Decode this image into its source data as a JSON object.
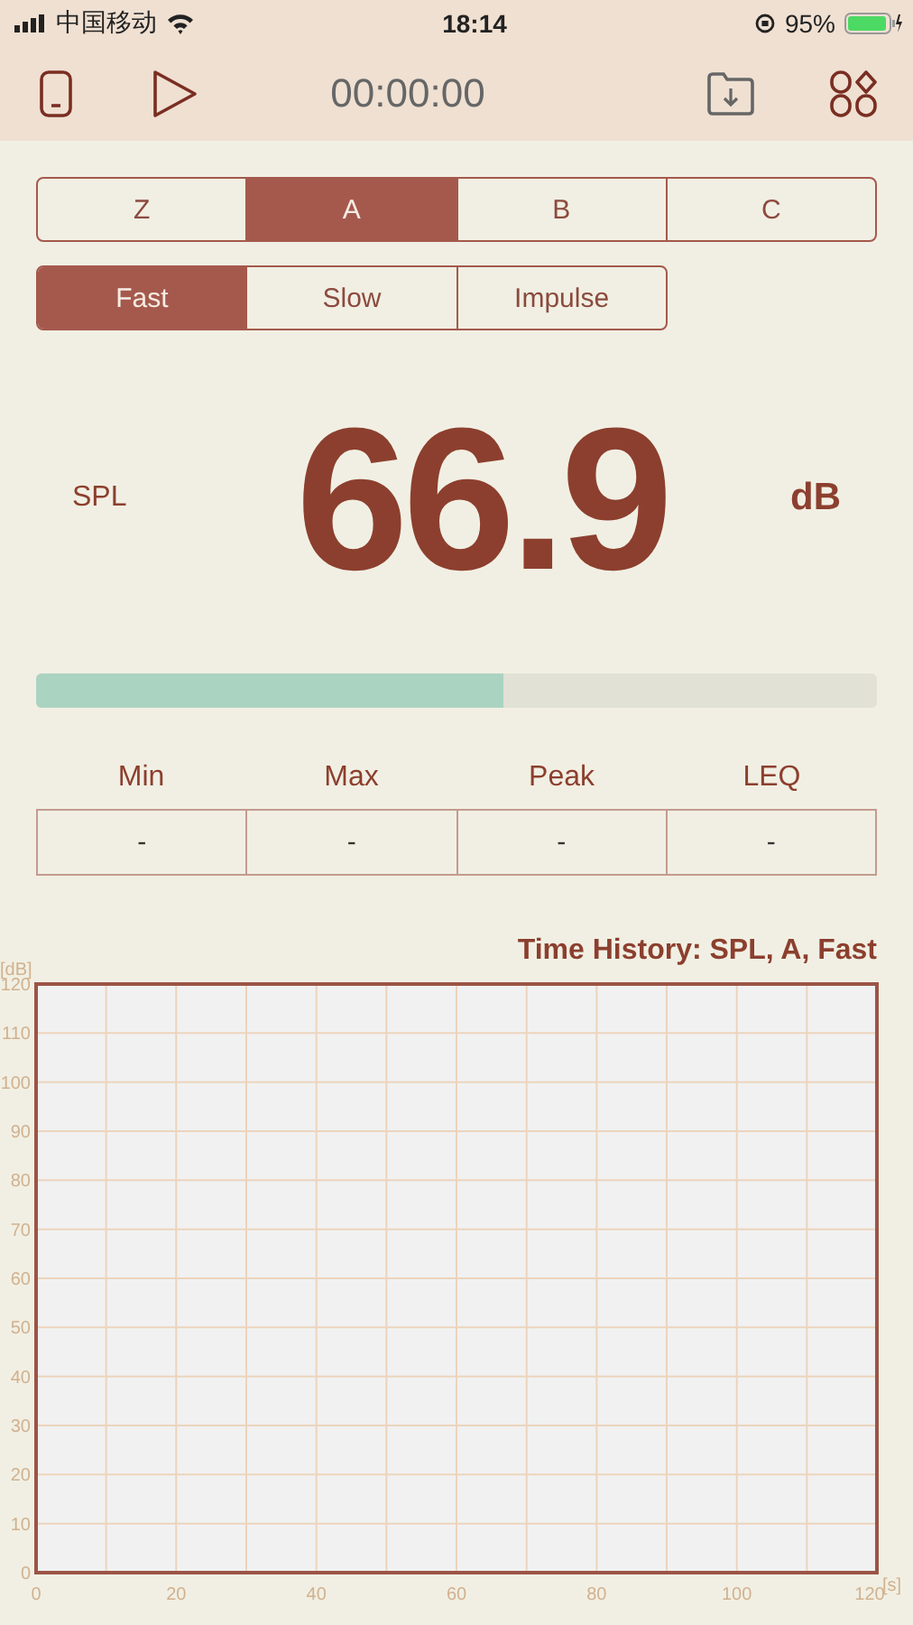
{
  "status_bar": {
    "carrier": "中国移动",
    "time": "18:14",
    "battery": "95%"
  },
  "toolbar": {
    "timer": "00:00:00"
  },
  "weighting_tabs": [
    {
      "label": "Z",
      "selected": false
    },
    {
      "label": "A",
      "selected": true
    },
    {
      "label": "B",
      "selected": false
    },
    {
      "label": "C",
      "selected": false
    }
  ],
  "time_tabs": [
    {
      "label": "Fast",
      "selected": true
    },
    {
      "label": "Slow",
      "selected": false
    },
    {
      "label": "Impulse",
      "selected": false
    }
  ],
  "reading": {
    "label": "SPL",
    "value": "66.9",
    "unit": "dB"
  },
  "meter": {
    "level": 0.555
  },
  "stats": [
    {
      "label": "Min",
      "value": "-"
    },
    {
      "label": "Max",
      "value": "-"
    },
    {
      "label": "Peak",
      "value": "-"
    },
    {
      "label": "LEQ",
      "value": "-"
    }
  ],
  "history": {
    "chart_data": {
      "type": "line",
      "grid": true,
      "title": "Time History: SPL, A, Fast",
      "xlabel": "[s]",
      "ylabel": "[dB]",
      "xlim": [
        0,
        120
      ],
      "ylim": [
        0,
        120
      ],
      "xticks": [
        0,
        20,
        40,
        60,
        80,
        100,
        120
      ],
      "yticks": [
        0,
        10,
        20,
        30,
        40,
        50,
        60,
        70,
        80,
        90,
        100,
        110,
        120
      ]
    }
  }
}
